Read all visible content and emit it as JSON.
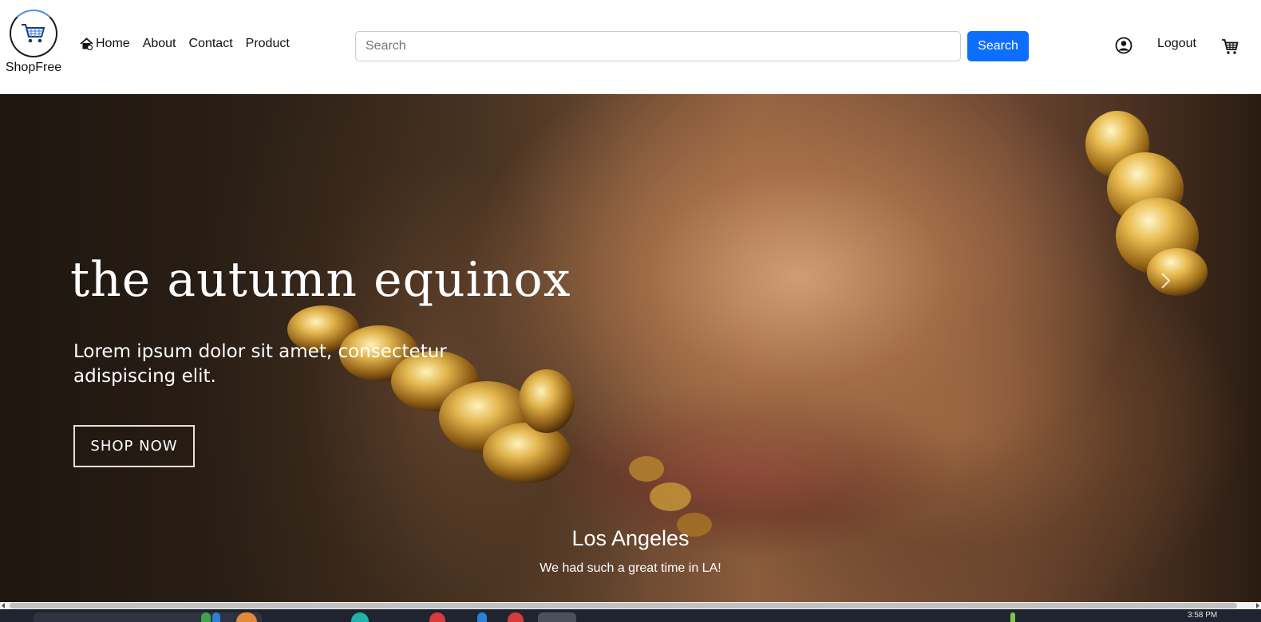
{
  "brand": {
    "name": "ShopFree",
    "icon": "shopping-cart-logo-icon"
  },
  "nav": {
    "home": "Home",
    "about": "About",
    "contact": "Contact",
    "product": "Product"
  },
  "search": {
    "placeholder": "Search",
    "button": "Search"
  },
  "account": {
    "user_icon": "user-circle-icon",
    "logout": "Logout",
    "cart_icon": "shopping-cart-icon"
  },
  "hero": {
    "title": "the autumn equinox",
    "text": "Lorem ipsum dolor sit amet, consectetur adispiscing elit.",
    "cta": "SHOP NOW",
    "caption_title": "Los Angeles",
    "caption_text": "We had such a great time in LA!"
  },
  "taskbar": {
    "time": "3:58 PM"
  },
  "colors": {
    "accent": "#0d6efd",
    "nav_text": "#111111",
    "hero_text": "#ffffff"
  }
}
